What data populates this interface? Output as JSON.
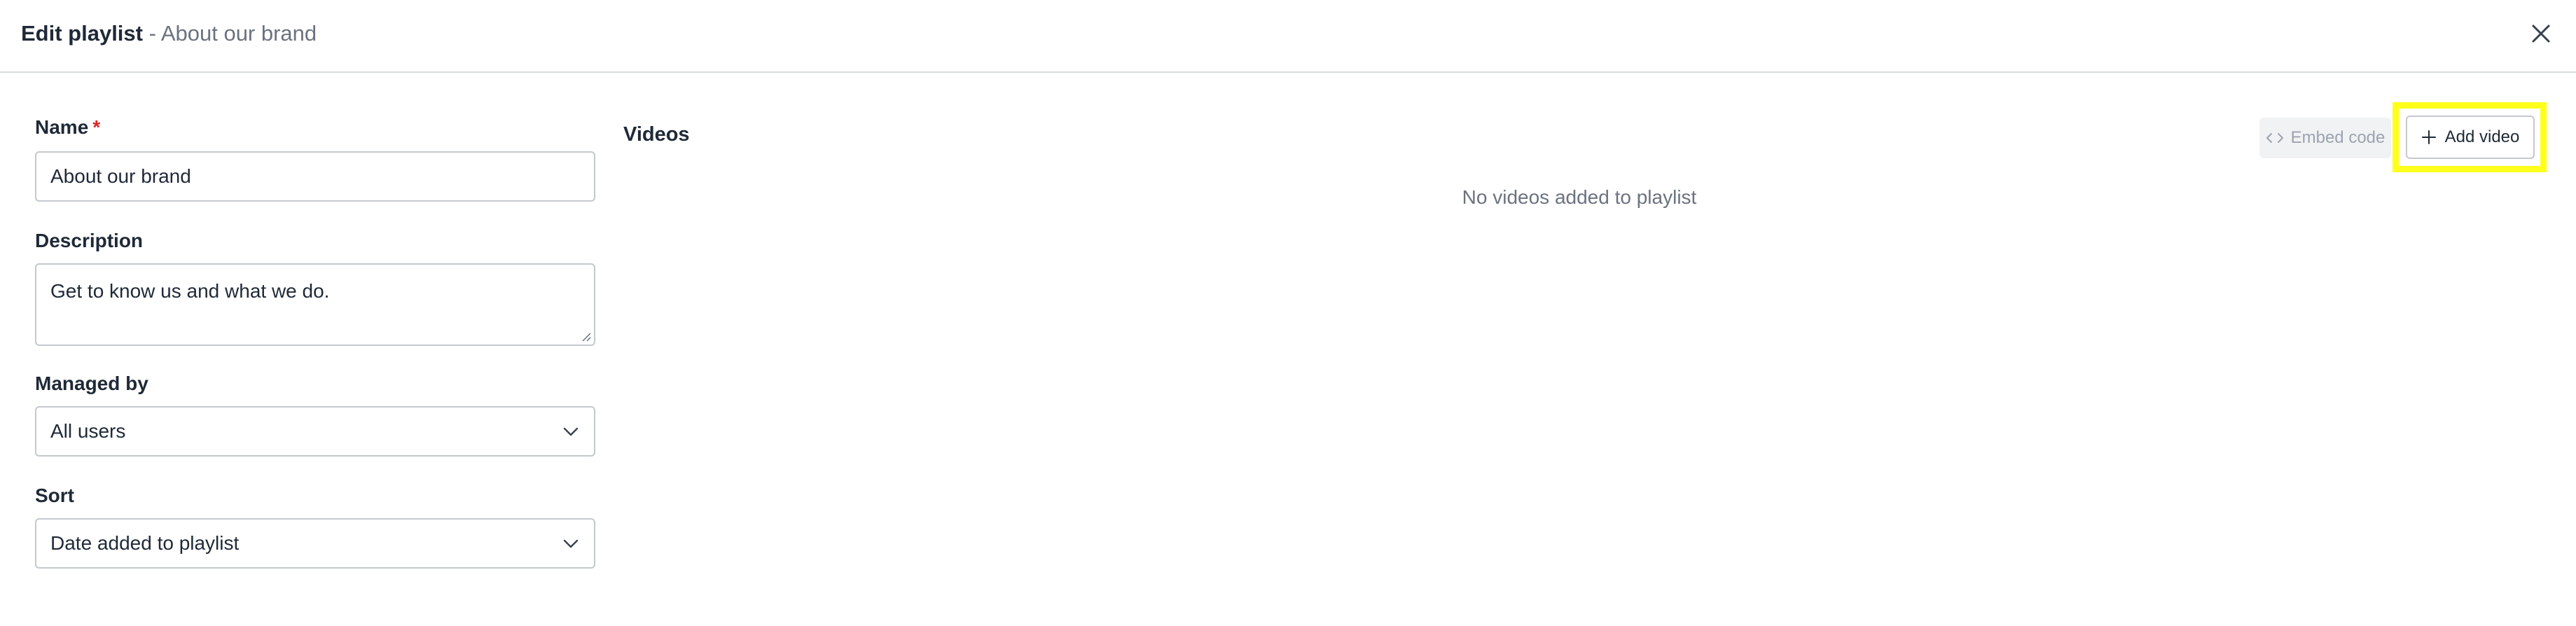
{
  "header": {
    "title": "Edit playlist",
    "separator": " - ",
    "subtitle": "About our brand",
    "close_icon": "close-icon"
  },
  "form": {
    "name": {
      "label": "Name",
      "required_mark": "*",
      "value": "About our brand"
    },
    "description": {
      "label": "Description",
      "value": "Get to know us and what we do."
    },
    "managed_by": {
      "label": "Managed by",
      "selected": "All users"
    },
    "sort": {
      "label": "Sort",
      "selected": "Date added to playlist"
    }
  },
  "videos": {
    "title": "Videos",
    "embed_label": "Embed code",
    "embed_icon": "code-icon",
    "add_label": "Add video",
    "add_icon": "plus-icon",
    "empty_message": "No videos added to playlist"
  },
  "colors": {
    "highlight": "#ffff1a",
    "required": "#dc2626",
    "muted_text": "#6b7280",
    "border": "#c4c8cf"
  }
}
